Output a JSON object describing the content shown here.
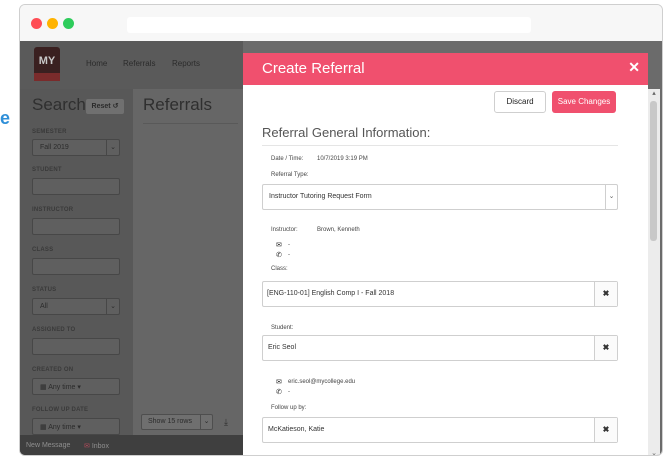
{
  "edge_fragment": "e",
  "nav": {
    "logo": "MY",
    "links": [
      "Home",
      "Referrals",
      "Reports"
    ]
  },
  "sidebar": {
    "title": "Search",
    "reset_label": "Reset",
    "semester_label": "SEMESTER",
    "semester_value": "Fall 2019",
    "student_label": "STUDENT",
    "instructor_label": "INSTRUCTOR",
    "class_label": "CLASS",
    "status_label": "STATUS",
    "status_value": "All",
    "assigned_label": "ASSIGNED TO",
    "created_label": "CREATED ON",
    "created_value": "Any time",
    "followup_label": "FOLLOW UP DATE",
    "followup_value": "Any time"
  },
  "main": {
    "title": "Referrals",
    "show_rows": "Show 15 rows"
  },
  "bottom": {
    "new_message": "New Message",
    "inbox": "Inbox"
  },
  "modal": {
    "title": "Create Referral",
    "discard_label": "Discard",
    "save_label": "Save Changes",
    "section_title": "Referral General Information:",
    "datetime_label": "Date / Time:",
    "datetime_value": "10/7/2019 3:19 PM",
    "type_label": "Referral Type:",
    "type_value": "Instructor Tutoring Request Form",
    "instructor_label": "Instructor:",
    "instructor_value": "Brown, Kenneth",
    "instructor_email": "-",
    "instructor_phone": "-",
    "class_label": "Class:",
    "class_value": "[ENG-110-01] English Comp I - Fall 2018",
    "student_label": "Student:",
    "student_value": "Eric Seol",
    "student_email": "eric.seol@mycollege.edu",
    "student_phone": "-",
    "followup_label": "Follow up by:",
    "followup_value": "McKatieson, Katie"
  },
  "colors": {
    "accent": "#f0506e",
    "overlay": "#6b6b6b"
  }
}
